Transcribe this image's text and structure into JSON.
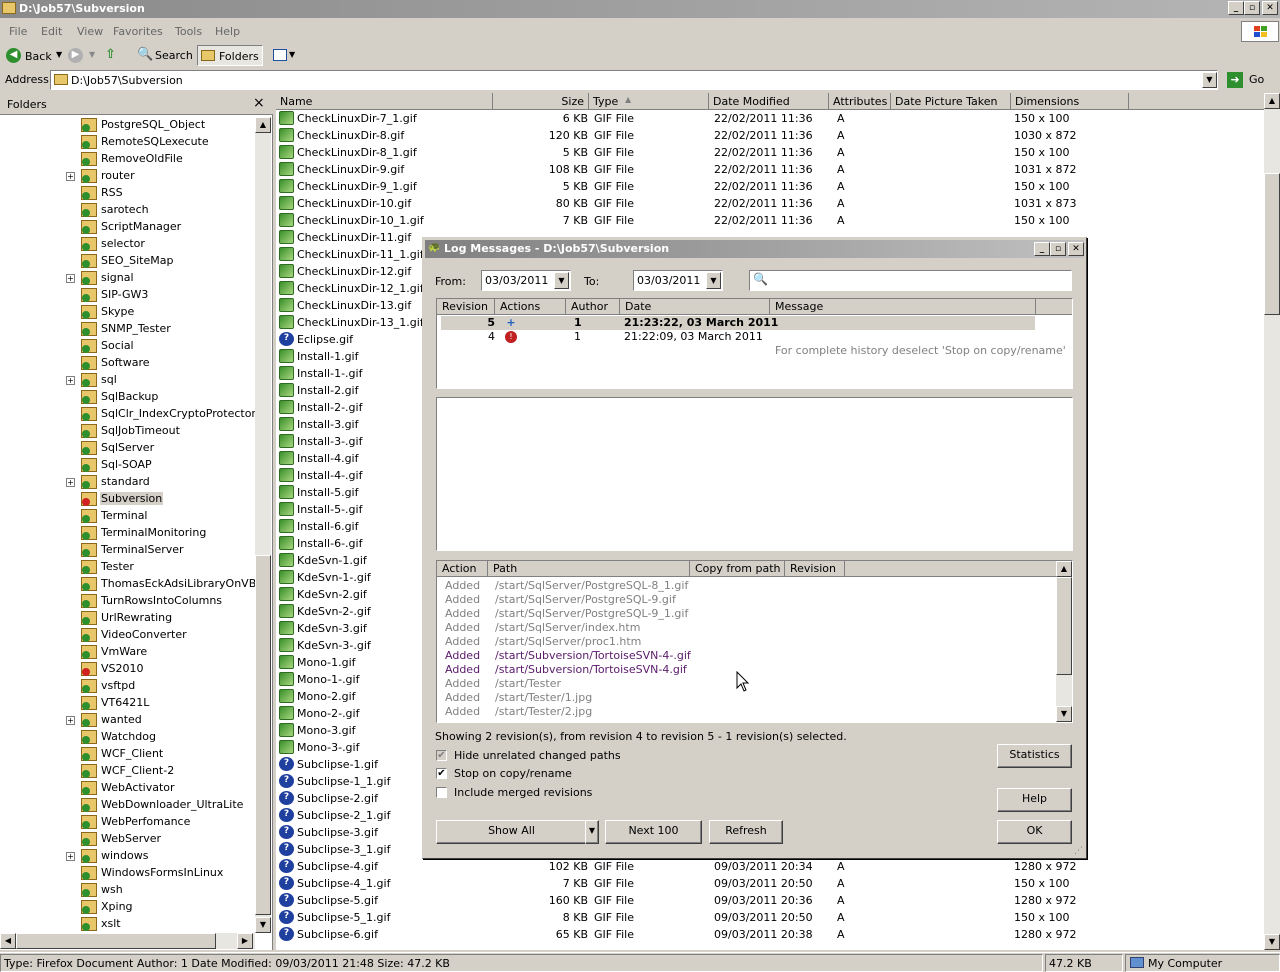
{
  "window": {
    "title": "D:\\Job57\\Subversion"
  },
  "menu": {
    "items": [
      "File",
      "Edit",
      "View",
      "Favorites",
      "Tools",
      "Help"
    ]
  },
  "toolbar": {
    "back": "Back",
    "search": "Search",
    "folders": "Folders"
  },
  "address": {
    "label": "Address",
    "value": "D:\\Job57\\Subversion",
    "go": "Go"
  },
  "folders": {
    "title": "Folders",
    "items": [
      {
        "label": "PostgreSQL_Object",
        "expander": false,
        "selected": false,
        "icon": "folder-svn-icon"
      },
      {
        "label": "RemoteSQLexecute",
        "expander": false,
        "selected": false,
        "icon": "folder-svn-icon"
      },
      {
        "label": "RemoveOldFile",
        "expander": false,
        "selected": false,
        "icon": "folder-svn-icon"
      },
      {
        "label": "router",
        "expander": true,
        "selected": false,
        "icon": "folder-svn-icon"
      },
      {
        "label": "RSS",
        "expander": false,
        "selected": false,
        "icon": "folder-svn-icon"
      },
      {
        "label": "sarotech",
        "expander": false,
        "selected": false,
        "icon": "folder-svn-icon"
      },
      {
        "label": "ScriptManager",
        "expander": false,
        "selected": false,
        "icon": "folder-svn-icon"
      },
      {
        "label": "selector",
        "expander": false,
        "selected": false,
        "icon": "folder-svn-icon"
      },
      {
        "label": "SEO_SiteMap",
        "expander": false,
        "selected": false,
        "icon": "folder-svn-icon"
      },
      {
        "label": "signal",
        "expander": true,
        "selected": false,
        "icon": "folder-svn-icon"
      },
      {
        "label": "SIP-GW3",
        "expander": false,
        "selected": false,
        "icon": "folder-svn-icon"
      },
      {
        "label": "Skype",
        "expander": false,
        "selected": false,
        "icon": "folder-svn-icon"
      },
      {
        "label": "SNMP_Tester",
        "expander": false,
        "selected": false,
        "icon": "folder-svn-icon"
      },
      {
        "label": "Social",
        "expander": false,
        "selected": false,
        "icon": "folder-svn-icon"
      },
      {
        "label": "Software",
        "expander": false,
        "selected": false,
        "icon": "folder-svn-icon"
      },
      {
        "label": "sql",
        "expander": true,
        "selected": false,
        "icon": "folder-svn-icon"
      },
      {
        "label": "SqlBackup",
        "expander": false,
        "selected": false,
        "icon": "folder-svn-icon"
      },
      {
        "label": "SqlClr_IndexCryptoProtector",
        "expander": false,
        "selected": false,
        "icon": "folder-svn-icon"
      },
      {
        "label": "SqlJobTimeout",
        "expander": false,
        "selected": false,
        "icon": "folder-svn-icon"
      },
      {
        "label": "SqlServer",
        "expander": false,
        "selected": false,
        "icon": "folder-svn-icon"
      },
      {
        "label": "Sql-SOAP",
        "expander": false,
        "selected": false,
        "icon": "folder-svn-icon"
      },
      {
        "label": "standard",
        "expander": true,
        "selected": false,
        "icon": "folder-svn-icon"
      },
      {
        "label": "Subversion",
        "expander": false,
        "selected": true,
        "icon": "folder-svn-modified-icon"
      },
      {
        "label": "Terminal",
        "expander": false,
        "selected": false,
        "icon": "folder-svn-icon"
      },
      {
        "label": "TerminalMonitoring",
        "expander": false,
        "selected": false,
        "icon": "folder-svn-icon"
      },
      {
        "label": "TerminalServer",
        "expander": false,
        "selected": false,
        "icon": "folder-svn-icon"
      },
      {
        "label": "Tester",
        "expander": false,
        "selected": false,
        "icon": "folder-svn-icon"
      },
      {
        "label": "ThomasEckAdsiLibraryOnVBNet",
        "expander": false,
        "selected": false,
        "icon": "folder-svn-icon"
      },
      {
        "label": "TurnRowsIntoColumns",
        "expander": false,
        "selected": false,
        "icon": "folder-svn-icon"
      },
      {
        "label": "UrlRewrating",
        "expander": false,
        "selected": false,
        "icon": "folder-svn-icon"
      },
      {
        "label": "VideoConverter",
        "expander": false,
        "selected": false,
        "icon": "folder-svn-icon"
      },
      {
        "label": "VmWare",
        "expander": false,
        "selected": false,
        "icon": "folder-svn-icon"
      },
      {
        "label": "VS2010",
        "expander": false,
        "selected": false,
        "icon": "folder-svn-modified-icon"
      },
      {
        "label": "vsftpd",
        "expander": false,
        "selected": false,
        "icon": "folder-svn-icon"
      },
      {
        "label": "VT6421L",
        "expander": false,
        "selected": false,
        "icon": "folder-svn-icon"
      },
      {
        "label": "wanted",
        "expander": true,
        "selected": false,
        "icon": "folder-svn-icon"
      },
      {
        "label": "Watchdog",
        "expander": false,
        "selected": false,
        "icon": "folder-svn-icon"
      },
      {
        "label": "WCF_Client",
        "expander": false,
        "selected": false,
        "icon": "folder-svn-icon"
      },
      {
        "label": "WCF_Client-2",
        "expander": false,
        "selected": false,
        "icon": "folder-svn-icon"
      },
      {
        "label": "WebActivator",
        "expander": false,
        "selected": false,
        "icon": "folder-svn-icon"
      },
      {
        "label": "WebDownloader_UltraLite",
        "expander": false,
        "selected": false,
        "icon": "folder-svn-icon"
      },
      {
        "label": "WebPerfomance",
        "expander": false,
        "selected": false,
        "icon": "folder-svn-icon"
      },
      {
        "label": "WebServer",
        "expander": false,
        "selected": false,
        "icon": "folder-svn-icon"
      },
      {
        "label": "windows",
        "expander": true,
        "selected": false,
        "icon": "folder-svn-icon"
      },
      {
        "label": "WindowsFormsInLinux",
        "expander": false,
        "selected": false,
        "icon": "folder-svn-icon"
      },
      {
        "label": "wsh",
        "expander": false,
        "selected": false,
        "icon": "folder-svn-icon"
      },
      {
        "label": "Xping",
        "expander": false,
        "selected": false,
        "icon": "folder-svn-icon"
      },
      {
        "label": "xslt",
        "expander": false,
        "selected": false,
        "icon": "folder-svn-icon"
      }
    ]
  },
  "filelist": {
    "columns": [
      "Name",
      "Size",
      "Type",
      "Date Modified",
      "Attributes",
      "Date Picture Taken",
      "Dimensions"
    ],
    "rows": [
      {
        "name": "CheckLinuxDir-7_1.gif",
        "size": "6 KB",
        "type": "GIF File",
        "date": "22/02/2011 11:36",
        "attr": "A",
        "dims": "150 x 100",
        "icon": "svn-normal-icon"
      },
      {
        "name": "CheckLinuxDir-8.gif",
        "size": "120 KB",
        "type": "GIF File",
        "date": "22/02/2011 11:36",
        "attr": "A",
        "dims": "1030 x 872",
        "icon": "svn-normal-icon"
      },
      {
        "name": "CheckLinuxDir-8_1.gif",
        "size": "5 KB",
        "type": "GIF File",
        "date": "22/02/2011 11:36",
        "attr": "A",
        "dims": "150 x 100",
        "icon": "svn-normal-icon"
      },
      {
        "name": "CheckLinuxDir-9.gif",
        "size": "108 KB",
        "type": "GIF File",
        "date": "22/02/2011 11:36",
        "attr": "A",
        "dims": "1031 x 872",
        "icon": "svn-normal-icon"
      },
      {
        "name": "CheckLinuxDir-9_1.gif",
        "size": "5 KB",
        "type": "GIF File",
        "date": "22/02/2011 11:36",
        "attr": "A",
        "dims": "150 x 100",
        "icon": "svn-normal-icon"
      },
      {
        "name": "CheckLinuxDir-10.gif",
        "size": "80 KB",
        "type": "GIF File",
        "date": "22/02/2011 11:36",
        "attr": "A",
        "dims": "1031 x 873",
        "icon": "svn-normal-icon"
      },
      {
        "name": "CheckLinuxDir-10_1.gif",
        "size": "7 KB",
        "type": "GIF File",
        "date": "22/02/2011 11:36",
        "attr": "A",
        "dims": "150 x 100",
        "icon": "svn-normal-icon"
      },
      {
        "name": "CheckLinuxDir-11.gif",
        "size": "",
        "type": "",
        "date": "",
        "attr": "",
        "dims": "",
        "icon": "svn-normal-icon"
      },
      {
        "name": "CheckLinuxDir-11_1.gif",
        "size": "",
        "type": "",
        "date": "",
        "attr": "",
        "dims": "",
        "icon": "svn-normal-icon"
      },
      {
        "name": "CheckLinuxDir-12.gif",
        "size": "",
        "type": "",
        "date": "",
        "attr": "",
        "dims": "",
        "icon": "svn-normal-icon"
      },
      {
        "name": "CheckLinuxDir-12_1.gif",
        "size": "",
        "type": "",
        "date": "",
        "attr": "",
        "dims": "",
        "icon": "svn-normal-icon"
      },
      {
        "name": "CheckLinuxDir-13.gif",
        "size": "",
        "type": "",
        "date": "",
        "attr": "",
        "dims": "",
        "icon": "svn-normal-icon"
      },
      {
        "name": "CheckLinuxDir-13_1.gif",
        "size": "",
        "type": "",
        "date": "",
        "attr": "",
        "dims": "",
        "icon": "svn-normal-icon"
      },
      {
        "name": "Eclipse.gif",
        "size": "",
        "type": "",
        "date": "",
        "attr": "",
        "dims": "",
        "icon": "svn-unversioned-icon"
      },
      {
        "name": "Install-1.gif",
        "size": "",
        "type": "",
        "date": "",
        "attr": "",
        "dims": "",
        "icon": "svn-normal-icon"
      },
      {
        "name": "Install-1-.gif",
        "size": "",
        "type": "",
        "date": "",
        "attr": "",
        "dims": "",
        "icon": "svn-normal-icon"
      },
      {
        "name": "Install-2.gif",
        "size": "",
        "type": "",
        "date": "",
        "attr": "",
        "dims": "",
        "icon": "svn-normal-icon"
      },
      {
        "name": "Install-2-.gif",
        "size": "",
        "type": "",
        "date": "",
        "attr": "",
        "dims": "",
        "icon": "svn-normal-icon"
      },
      {
        "name": "Install-3.gif",
        "size": "",
        "type": "",
        "date": "",
        "attr": "",
        "dims": "",
        "icon": "svn-normal-icon"
      },
      {
        "name": "Install-3-.gif",
        "size": "",
        "type": "",
        "date": "",
        "attr": "",
        "dims": "",
        "icon": "svn-normal-icon"
      },
      {
        "name": "Install-4.gif",
        "size": "",
        "type": "",
        "date": "",
        "attr": "",
        "dims": "",
        "icon": "svn-normal-icon"
      },
      {
        "name": "Install-4-.gif",
        "size": "",
        "type": "",
        "date": "",
        "attr": "",
        "dims": "",
        "icon": "svn-normal-icon"
      },
      {
        "name": "Install-5.gif",
        "size": "",
        "type": "",
        "date": "",
        "attr": "",
        "dims": "",
        "icon": "svn-normal-icon"
      },
      {
        "name": "Install-5-.gif",
        "size": "",
        "type": "",
        "date": "",
        "attr": "",
        "dims": "",
        "icon": "svn-normal-icon"
      },
      {
        "name": "Install-6.gif",
        "size": "",
        "type": "",
        "date": "",
        "attr": "",
        "dims": "",
        "icon": "svn-normal-icon"
      },
      {
        "name": "Install-6-.gif",
        "size": "",
        "type": "",
        "date": "",
        "attr": "",
        "dims": "",
        "icon": "svn-normal-icon"
      },
      {
        "name": "KdeSvn-1.gif",
        "size": "",
        "type": "",
        "date": "",
        "attr": "",
        "dims": "",
        "icon": "svn-normal-icon"
      },
      {
        "name": "KdeSvn-1-.gif",
        "size": "",
        "type": "",
        "date": "",
        "attr": "",
        "dims": "",
        "icon": "svn-normal-icon"
      },
      {
        "name": "KdeSvn-2.gif",
        "size": "",
        "type": "",
        "date": "",
        "attr": "",
        "dims": "",
        "icon": "svn-normal-icon"
      },
      {
        "name": "KdeSvn-2-.gif",
        "size": "",
        "type": "",
        "date": "",
        "attr": "",
        "dims": "",
        "icon": "svn-normal-icon"
      },
      {
        "name": "KdeSvn-3.gif",
        "size": "",
        "type": "",
        "date": "",
        "attr": "",
        "dims": "",
        "icon": "svn-normal-icon"
      },
      {
        "name": "KdeSvn-3-.gif",
        "size": "",
        "type": "",
        "date": "",
        "attr": "",
        "dims": "",
        "icon": "svn-normal-icon"
      },
      {
        "name": "Mono-1.gif",
        "size": "",
        "type": "",
        "date": "",
        "attr": "",
        "dims": "",
        "icon": "svn-normal-icon"
      },
      {
        "name": "Mono-1-.gif",
        "size": "",
        "type": "",
        "date": "",
        "attr": "",
        "dims": "",
        "icon": "svn-normal-icon"
      },
      {
        "name": "Mono-2.gif",
        "size": "",
        "type": "",
        "date": "",
        "attr": "",
        "dims": "",
        "icon": "svn-normal-icon"
      },
      {
        "name": "Mono-2-.gif",
        "size": "",
        "type": "",
        "date": "",
        "attr": "",
        "dims": "",
        "icon": "svn-normal-icon"
      },
      {
        "name": "Mono-3.gif",
        "size": "",
        "type": "",
        "date": "",
        "attr": "",
        "dims": "",
        "icon": "svn-normal-icon"
      },
      {
        "name": "Mono-3-.gif",
        "size": "",
        "type": "",
        "date": "",
        "attr": "",
        "dims": "",
        "icon": "svn-normal-icon"
      },
      {
        "name": "Subclipse-1.gif",
        "size": "",
        "type": "",
        "date": "",
        "attr": "",
        "dims": "",
        "icon": "svn-unversioned-icon"
      },
      {
        "name": "Subclipse-1_1.gif",
        "size": "",
        "type": "",
        "date": "",
        "attr": "",
        "dims": "",
        "icon": "svn-unversioned-icon"
      },
      {
        "name": "Subclipse-2.gif",
        "size": "",
        "type": "",
        "date": "",
        "attr": "",
        "dims": "",
        "icon": "svn-unversioned-icon"
      },
      {
        "name": "Subclipse-2_1.gif",
        "size": "",
        "type": "",
        "date": "",
        "attr": "",
        "dims": "",
        "icon": "svn-unversioned-icon"
      },
      {
        "name": "Subclipse-3.gif",
        "size": "",
        "type": "",
        "date": "",
        "attr": "",
        "dims": "",
        "icon": "svn-unversioned-icon"
      },
      {
        "name": "Subclipse-3_1.gif",
        "size": "",
        "type": "",
        "date": "",
        "attr": "",
        "dims": "",
        "icon": "svn-unversioned-icon"
      },
      {
        "name": "Subclipse-4.gif",
        "size": "102 KB",
        "type": "GIF File",
        "date": "09/03/2011 20:34",
        "attr": "A",
        "dims": "1280 x 972",
        "icon": "svn-unversioned-icon"
      },
      {
        "name": "Subclipse-4_1.gif",
        "size": "7 KB",
        "type": "GIF File",
        "date": "09/03/2011 20:50",
        "attr": "A",
        "dims": "150 x 100",
        "icon": "svn-unversioned-icon"
      },
      {
        "name": "Subclipse-5.gif",
        "size": "160 KB",
        "type": "GIF File",
        "date": "09/03/2011 20:36",
        "attr": "A",
        "dims": "1280 x 972",
        "icon": "svn-unversioned-icon"
      },
      {
        "name": "Subclipse-5_1.gif",
        "size": "8 KB",
        "type": "GIF File",
        "date": "09/03/2011 20:50",
        "attr": "A",
        "dims": "150 x 100",
        "icon": "svn-unversioned-icon"
      },
      {
        "name": "Subclipse-6.gif",
        "size": "65 KB",
        "type": "GIF File",
        "date": "09/03/2011 20:38",
        "attr": "A",
        "dims": "1280 x 972",
        "icon": "svn-unversioned-icon"
      }
    ]
  },
  "dialog": {
    "title": "Log Messages - D:\\Job57\\Subversion",
    "from_label": "From:",
    "from_value": "03/03/2011",
    "to_label": "To:",
    "to_value": "03/03/2011",
    "search_placeholder": "",
    "rev_columns": [
      "Revision",
      "Actions",
      "Author",
      "Date",
      "Message"
    ],
    "revisions": [
      {
        "revision": "5",
        "author": "1",
        "date": "21:23:22, 03 March 2011",
        "message": "",
        "selected": true,
        "action_icon": "added-icon"
      },
      {
        "revision": "4",
        "author": "1",
        "date": "21:22:09, 03 March 2011",
        "message": "",
        "selected": false,
        "action_icon": "modified-icon"
      }
    ],
    "history_hint": "For complete history deselect 'Stop on copy/rename'",
    "path_columns": [
      "Action",
      "Path",
      "Copy from path",
      "Revision"
    ],
    "paths": [
      {
        "action": "Added",
        "path": "/start/SqlServer/PostgreSQL-8_1.gif",
        "related": false
      },
      {
        "action": "Added",
        "path": "/start/SqlServer/PostgreSQL-9.gif",
        "related": false
      },
      {
        "action": "Added",
        "path": "/start/SqlServer/PostgreSQL-9_1.gif",
        "related": false
      },
      {
        "action": "Added",
        "path": "/start/SqlServer/index.htm",
        "related": false
      },
      {
        "action": "Added",
        "path": "/start/SqlServer/proc1.htm",
        "related": false
      },
      {
        "action": "Added",
        "path": "/start/Subversion/TortoiseSVN-4-.gif",
        "related": true
      },
      {
        "action": "Added",
        "path": "/start/Subversion/TortoiseSVN-4.gif",
        "related": true
      },
      {
        "action": "Added",
        "path": "/start/Tester",
        "related": false
      },
      {
        "action": "Added",
        "path": "/start/Tester/1.jpg",
        "related": false
      },
      {
        "action": "Added",
        "path": "/start/Tester/2.jpg",
        "related": false
      }
    ],
    "summary": "Showing 2 revision(s), from revision 4 to revision 5 - 1 revision(s) selected.",
    "checkboxes": [
      {
        "label": "Hide unrelated changed paths",
        "checked": true,
        "disabled": true
      },
      {
        "label": "Stop on copy/rename",
        "checked": true,
        "disabled": false
      },
      {
        "label": "Include merged revisions",
        "checked": false,
        "disabled": false
      }
    ],
    "buttons": {
      "statistics": "Statistics",
      "help": "Help",
      "show_all": "Show All",
      "next": "Next 100",
      "refresh": "Refresh",
      "ok": "OK"
    }
  },
  "status": {
    "left": "Type: Firefox Document Author: 1 Date Modified: 09/03/2011 21:48 Size: 47.2 KB",
    "size": "47.2 KB",
    "zone": "My Computer"
  }
}
